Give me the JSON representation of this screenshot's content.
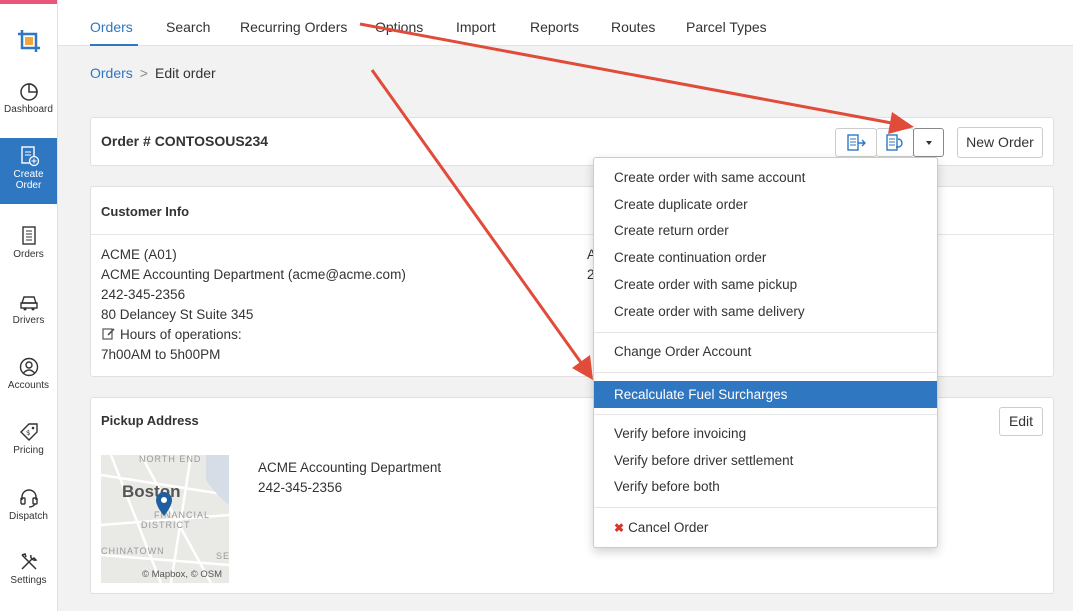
{
  "sidebar": {
    "items": [
      {
        "label": "Dashboard",
        "icon": "pie-chart-icon"
      },
      {
        "label": "Create Order",
        "icon": "create-order-icon",
        "active": true
      },
      {
        "label": "Orders",
        "icon": "orders-icon"
      },
      {
        "label": "Drivers",
        "icon": "car-icon"
      },
      {
        "label": "Accounts",
        "icon": "user-circle-icon"
      },
      {
        "label": "Pricing",
        "icon": "price-tag-icon"
      },
      {
        "label": "Dispatch",
        "icon": "headset-icon"
      },
      {
        "label": "Settings",
        "icon": "tools-icon"
      }
    ]
  },
  "tabs": [
    "Orders",
    "Search",
    "Recurring Orders",
    "Options",
    "Import",
    "Reports",
    "Routes",
    "Parcel Types"
  ],
  "breadcrumb": {
    "root": "Orders",
    "separator": ">",
    "current": "Edit order"
  },
  "order": {
    "title": "Order # CONTOSOUS234",
    "new_order_label": "New Order"
  },
  "customer": {
    "title": "Customer Info",
    "lines": [
      "ACME (A01)",
      "ACME Accounting Department (acme@acme.com)",
      "242-345-2356",
      "80 Delancey St Suite 345"
    ],
    "hours_label": "Hours of operations:",
    "hours_value": "7h00AM to 5h00PM",
    "right_col": [
      "A",
      "2"
    ]
  },
  "pickup": {
    "title": "Pickup Address",
    "edit_label": "Edit",
    "name": "ACME Accounting Department",
    "phone": "242-345-2356",
    "map": {
      "north_end": "NORTH END",
      "city": "Boston",
      "financial": "FINANCIAL",
      "district": "DISTRICT",
      "chinatown": "CHINATOWN",
      "sea": "SEAP",
      "credit": "© Mapbox, © OSM"
    }
  },
  "dropdown": {
    "group1": [
      "Create order with same account",
      "Create duplicate order",
      "Create return order",
      "Create continuation order",
      "Create order with same pickup",
      "Create order with same delivery"
    ],
    "group2": [
      "Change Order Account"
    ],
    "group3": [
      "Recalculate Fuel Surcharges"
    ],
    "group4": [
      "Verify before invoicing",
      "Verify before driver settlement",
      "Verify before both"
    ],
    "cancel": "Cancel Order"
  },
  "colors": {
    "accent": "#2f77c0",
    "annotation_arrow": "#e04b3a",
    "cancel_icon": "#d9342b",
    "sidebar_top_bar": "#e8567a"
  }
}
